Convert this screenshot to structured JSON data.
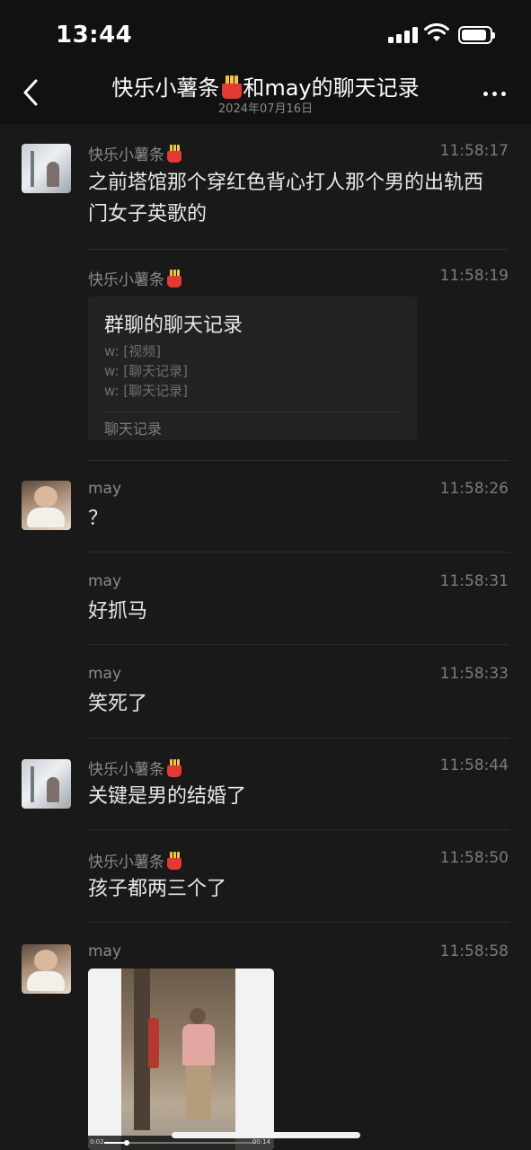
{
  "status_bar": {
    "time": "13:44",
    "battery_level": 0.9
  },
  "nav": {
    "title_prefix": "快乐小薯条",
    "title_suffix": "和may的聊天记录",
    "date": "2024年07月16日"
  },
  "icons": {
    "back": "chevron-left-icon",
    "more": "more-dots-icon",
    "emoji": "french-fries-emoji-icon"
  },
  "messages": [
    {
      "sender": "快乐小薯条",
      "time": "11:58:17",
      "text": "之前塔馆那个穿红色背心打人那个男的出轨西门女子英歌的"
    },
    {
      "sender": "快乐小薯条",
      "time": "11:58:19",
      "card": {
        "title": "群聊的聊天记录",
        "lines": [
          "w: [视频]",
          "w: [聊天记录]",
          "w: [聊天记录]"
        ],
        "footer": "聊天记录"
      }
    },
    {
      "sender": "may",
      "time": "11:58:26",
      "text": "？"
    },
    {
      "sender": "may",
      "time": "11:58:31",
      "text": "好抓马"
    },
    {
      "sender": "may",
      "time": "11:58:33",
      "text": "笑死了"
    },
    {
      "sender": "快乐小薯条",
      "time": "11:58:44",
      "text": "关键是男的结婚了"
    },
    {
      "sender": "快乐小薯条",
      "time": "11:58:50",
      "text": "孩子都两三个了"
    },
    {
      "sender": "may",
      "time": "11:58:58",
      "video": {
        "elapsed": "0:02",
        "duration": "00:14",
        "progress": 0.15
      }
    }
  ]
}
